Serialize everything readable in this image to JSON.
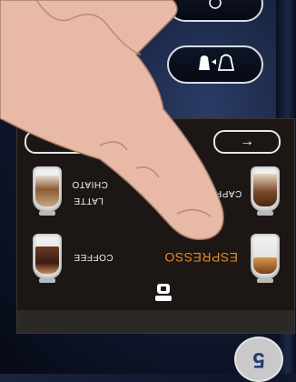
{
  "hardware": {
    "top_button_icon": "power-ring-icon",
    "cup_button_icon": "cup-size-icon",
    "left_button_icon": "partial-button-icon"
  },
  "screen": {
    "nav_left_glyph": "←",
    "nav_right_glyph": "→",
    "page_dots": [
      {
        "active": false
      },
      {
        "active": true
      }
    ],
    "drinks": [
      {
        "label": "LATTE MACCHIATO",
        "line1": "CHIATO",
        "line2": "LATTE",
        "active": false
      },
      {
        "label": "COFFEE",
        "active": false
      },
      {
        "label": "CAPPUCCINO",
        "visible_text": "CAPP",
        "active": false
      },
      {
        "label": "ESPRESSO",
        "active": true
      }
    ],
    "machine_icon": "coffee-machine-icon"
  },
  "step_badge": "5",
  "colors": {
    "active_label": "#e98a2a",
    "text": "#f2f2f2",
    "active_dot": "#ffffff",
    "inactive_dot": "#3a6ea5"
  }
}
